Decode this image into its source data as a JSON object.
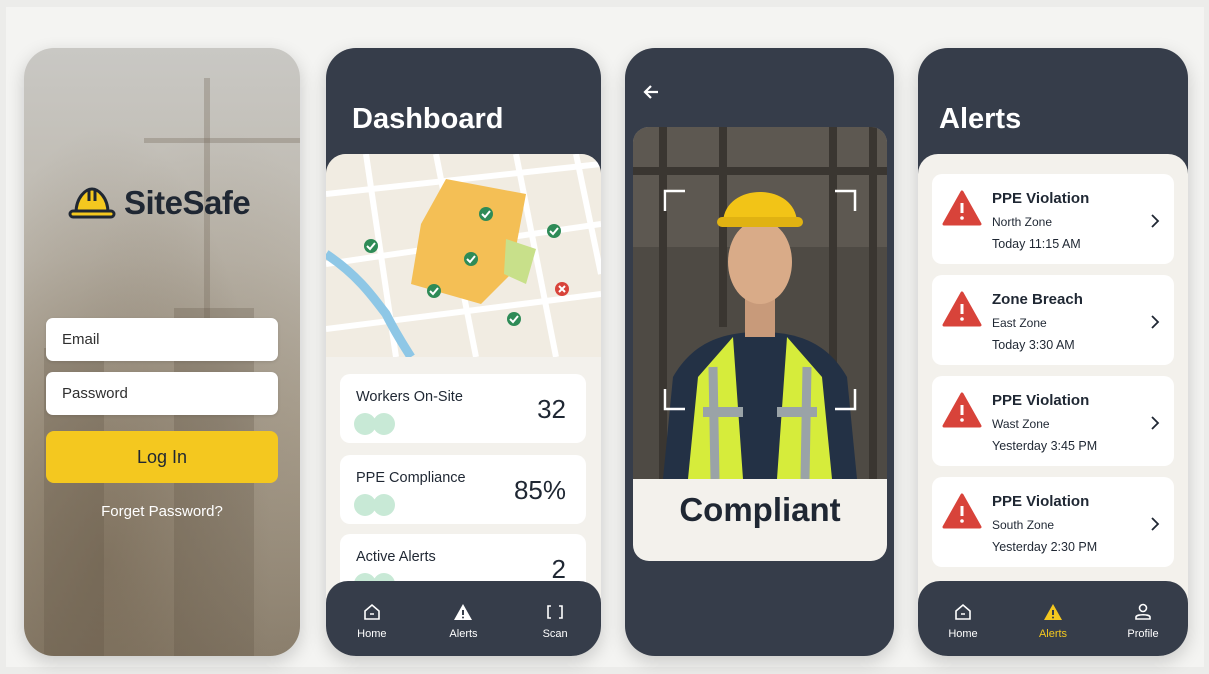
{
  "login": {
    "app_name": "SiteSafe",
    "email_placeholder": "Email",
    "password_placeholder": "Password",
    "login_label": "Log In",
    "forgot_label": "Forget Password?"
  },
  "dashboard": {
    "title": "Dashboard",
    "stats": [
      {
        "label": "Workers On-Site",
        "value": "32"
      },
      {
        "label": "PPE Compliance",
        "value": "85%"
      },
      {
        "label": "Active Alerts",
        "value": "2"
      }
    ],
    "tabs": [
      {
        "label": "Home",
        "icon": "home-icon"
      },
      {
        "label": "Alerts",
        "icon": "warning-icon"
      },
      {
        "label": "Scan",
        "icon": "scan-icon"
      }
    ]
  },
  "scan": {
    "status": "Compliant"
  },
  "alerts": {
    "title": "Alerts",
    "items": [
      {
        "title": "PPE Violation",
        "zone": "North Zone",
        "time": "Today 11:15 AM"
      },
      {
        "title": "Zone Breach",
        "zone": "East Zone",
        "time": "Today 3:30 AM"
      },
      {
        "title": "PPE Violation",
        "zone": "Wast Zone",
        "time": "Yesterday 3:45 PM"
      },
      {
        "title": "PPE Violation",
        "zone": "South Zone",
        "time": "Yesterday 2:30 PM"
      }
    ],
    "tabs": [
      {
        "label": "Home",
        "icon": "home-icon"
      },
      {
        "label": "Alerts",
        "icon": "warning-icon"
      },
      {
        "label": "Profile",
        "icon": "profile-icon"
      }
    ]
  },
  "colors": {
    "accent": "#f4c81f",
    "dark": "#363d4a",
    "danger": "#d8433a",
    "success": "#2e8b57"
  }
}
